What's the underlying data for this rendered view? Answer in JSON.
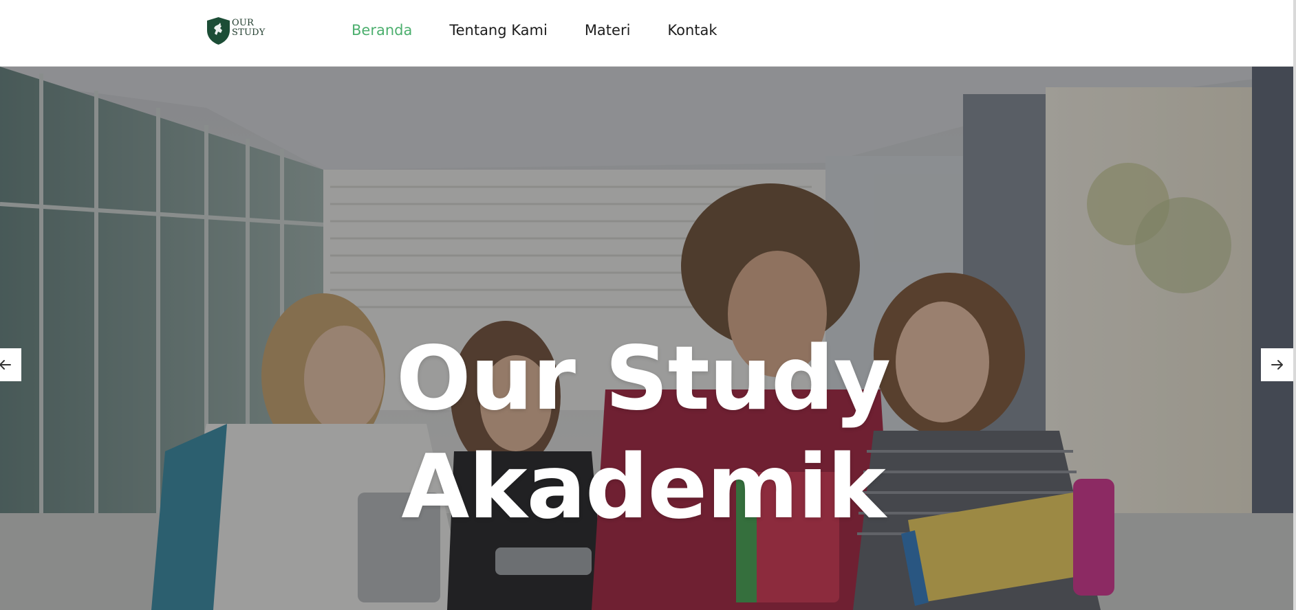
{
  "brand": {
    "logo_line1": "OUR",
    "logo_line2": "STUDY",
    "logo_color": "#1c4d36"
  },
  "nav": {
    "items": [
      {
        "label": "Beranda",
        "active": true
      },
      {
        "label": "Tentang Kami",
        "active": false
      },
      {
        "label": "Materi",
        "active": false
      },
      {
        "label": "Kontak",
        "active": false
      }
    ],
    "active_color": "#4caf6e"
  },
  "hero": {
    "title_line1": "Our Study",
    "title_line2": "Akademik",
    "image_alt": "students walking together",
    "prev_icon": "arrow-left-icon",
    "next_icon": "arrow-right-icon"
  }
}
